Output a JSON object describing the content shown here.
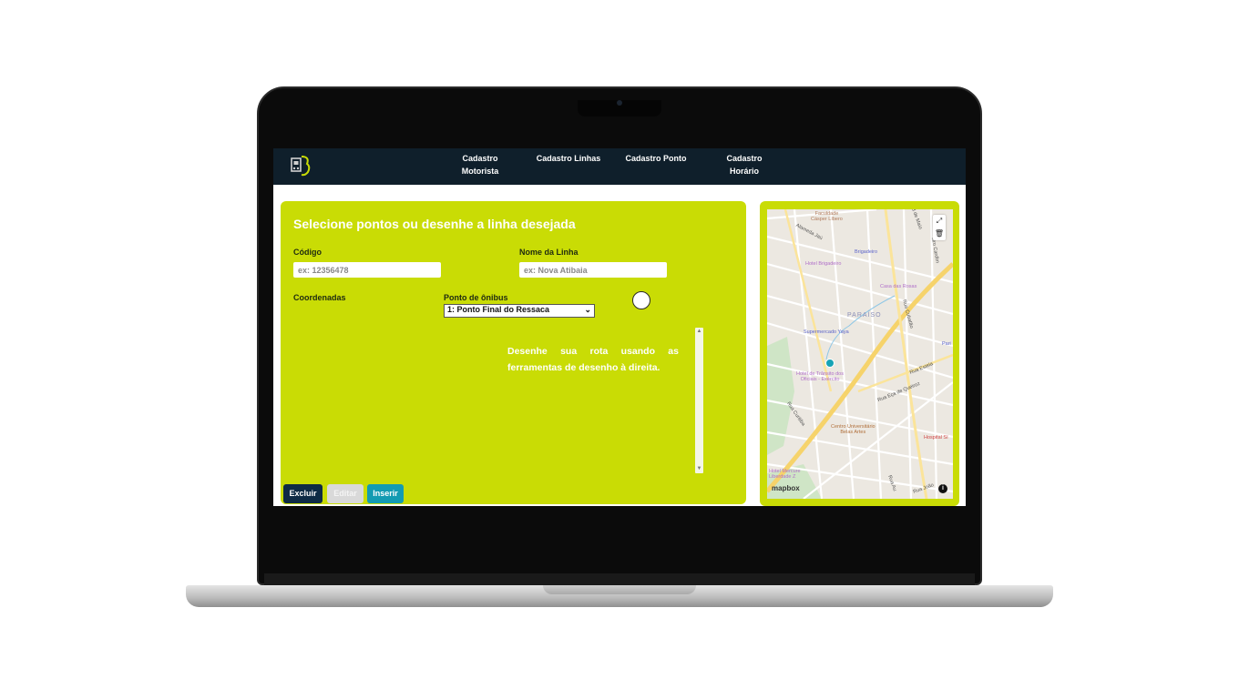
{
  "nav": {
    "items": [
      "Cadastro\nMotorista",
      "Cadastro Linhas",
      "Cadastro Ponto",
      "Cadastro\nHorário"
    ]
  },
  "form": {
    "title": "Selecione pontos ou desenhe a linha desejada",
    "codigo_label": "Código",
    "codigo_placeholder": "ex: 12356478",
    "nome_label": "Nome da Linha",
    "nome_placeholder": "ex: Nova Atibaia",
    "coordenadas_label": "Coordenadas",
    "ponto_label": "Ponto de ônibus",
    "ponto_selected": "1: Ponto Final do Ressaca",
    "instructions": "Desenhe sua rota usando as ferramentas de desenho à direita."
  },
  "buttons": {
    "excluir": "Excluir",
    "editar": "Editar",
    "inserir": "Inserir"
  },
  "map": {
    "labels": {
      "faculdade": "Faculdade\nCásper Líbero",
      "brigadeiro": "Brigadeiro",
      "hotel_brigadeiro": "Hotel Brigadeiro",
      "casa_rosas": "Casa das Rosas",
      "paraiso": "PARAÍSO",
      "supermercado": "Supermercado Yaya",
      "hotel_transito": "Hotel de Trânsito dos\nOficiais - Exército",
      "rua_eca": "Rua Eça de Queiroz",
      "rua_estela": "Rua Estela",
      "centro_univ": "Centro Universitário\nBelas Artes",
      "hospital": "Hospital Sí",
      "rua_curitiba": "Rua Curitiba",
      "rua_cubatao": "Rua Cubatão",
      "treze_maio": "13 de Maio",
      "sao_cardim": "stro Cardim",
      "alameda_jau": "Alameda Jaú",
      "paris": "Pari",
      "hotel_mercure": "Hotel Mercure\nLiberdade Z",
      "rua_aurora": "Rua Au",
      "rua_joao": "Rua João"
    },
    "attribution": "mapbox",
    "controls": {
      "draw_line": "⤢",
      "trash": "🗑",
      "info": "i"
    }
  },
  "colors": {
    "navbar": "#0f1f2b",
    "panel": "#c9dc05",
    "excluir": "#0e2b45",
    "inserir": "#139bb2",
    "editar": "#d9d9d9"
  }
}
